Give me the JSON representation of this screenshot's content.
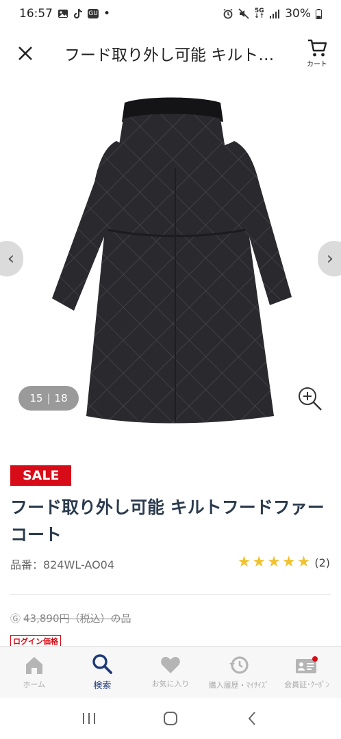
{
  "status": {
    "time": "16:57",
    "dot": "•",
    "gu": "GU",
    "battery": "30%",
    "network": "5G"
  },
  "header": {
    "title": "フード取り外し可能 キルト…",
    "cart_label": "カート"
  },
  "gallery": {
    "current": "15",
    "separator": "|",
    "total": "18"
  },
  "product": {
    "badge": "SALE",
    "title": "フード取り外し可能 キルトフードファーコート",
    "code": "品番：824WL-AO04",
    "rating": 5,
    "review_count": "(2)",
    "price_mark": "Ⓖ",
    "price": "43,890円（税込）の品",
    "login_badge": "ログイン価格"
  },
  "bottom_nav": [
    {
      "label": "ホーム",
      "icon": "home-icon"
    },
    {
      "label": "検索",
      "icon": "search-icon"
    },
    {
      "label": "お気に入り",
      "icon": "heart-icon"
    },
    {
      "label": "購入履歴・ﾏｲｻｲｽﾞ",
      "icon": "history-icon"
    },
    {
      "label": "会員証･ｸｰﾎﾟﾝ",
      "icon": "member-card-icon"
    }
  ],
  "colors": {
    "sale_red": "#d80c18",
    "title_navy": "#2b3b4e",
    "active_nav": "#1f3a7a",
    "star_gold": "#f2c12e"
  }
}
